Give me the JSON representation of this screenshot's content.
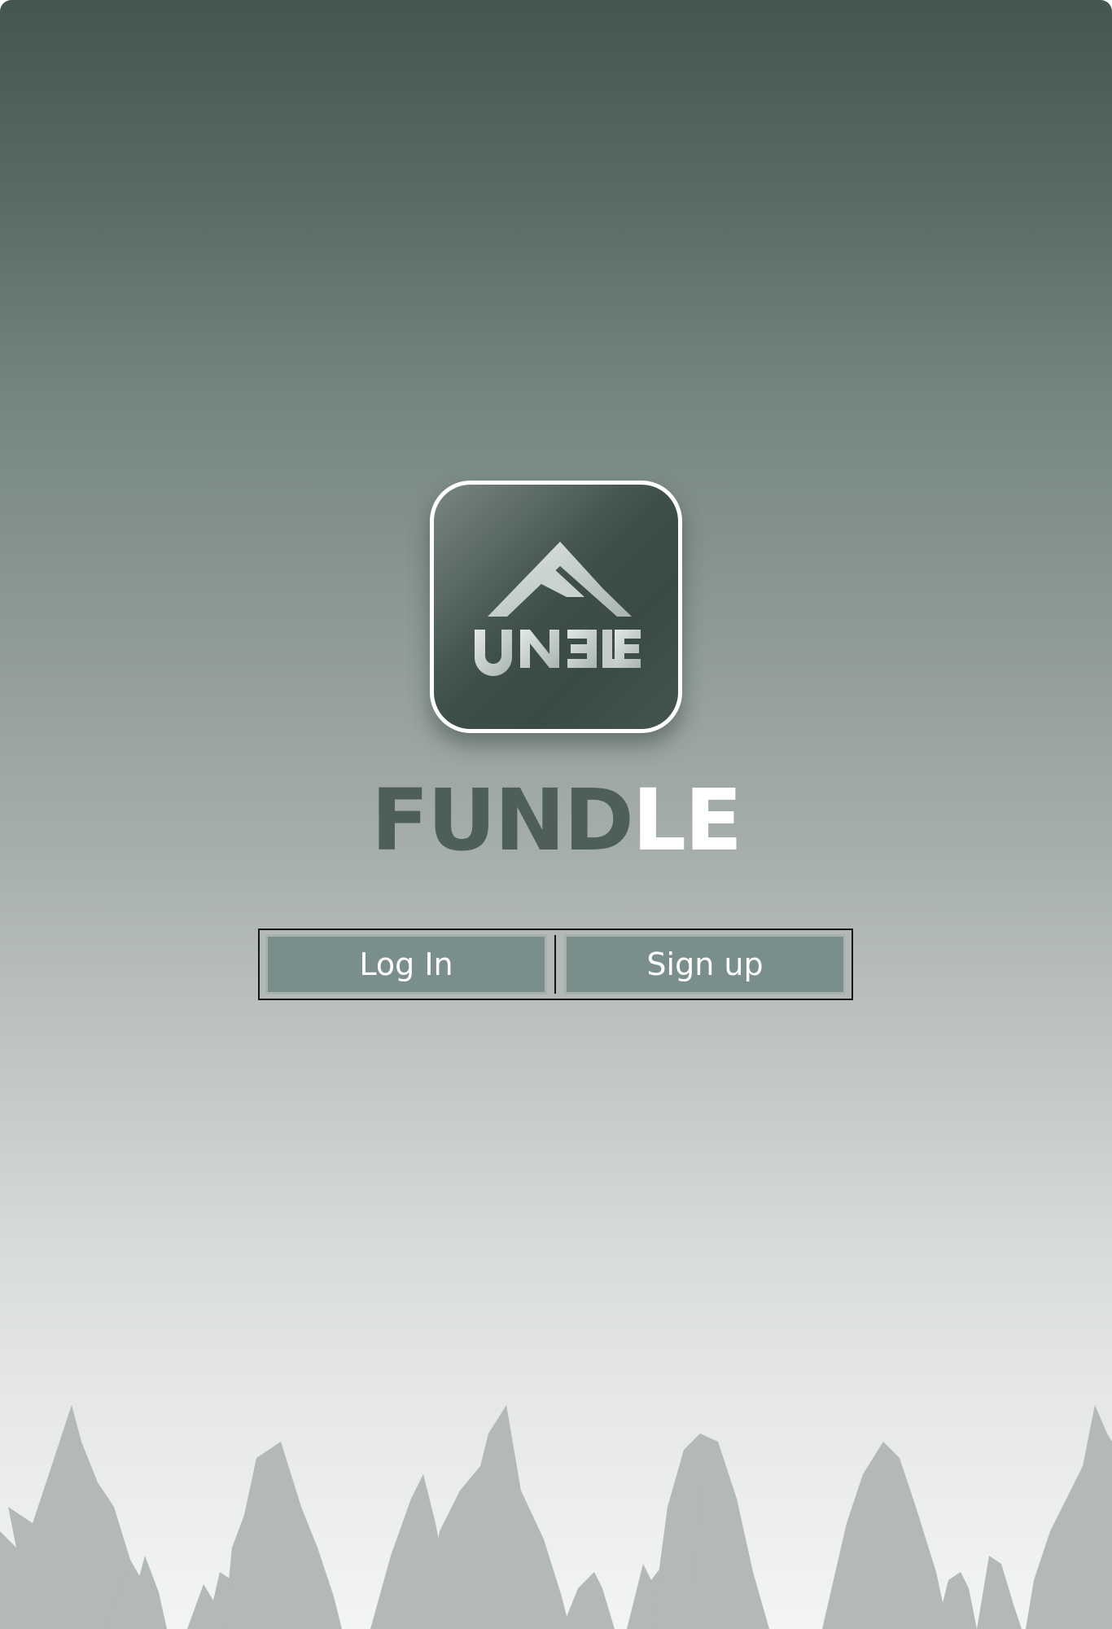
{
  "app": {
    "logo_icon": "fundle-logo-icon",
    "brand_part1": "FUND",
    "brand_part2": "LE",
    "brand_part1_color": "#4e5f5b",
    "brand_part2_color": "#ffffff"
  },
  "auth": {
    "login_label": "Log In",
    "signup_label": "Sign up",
    "button_color": "#7a8f8b"
  },
  "background": {
    "top_color": "#435651",
    "bottom_color": "#f3f4f4",
    "decoration_icon": "pine-tree-silhouettes"
  }
}
